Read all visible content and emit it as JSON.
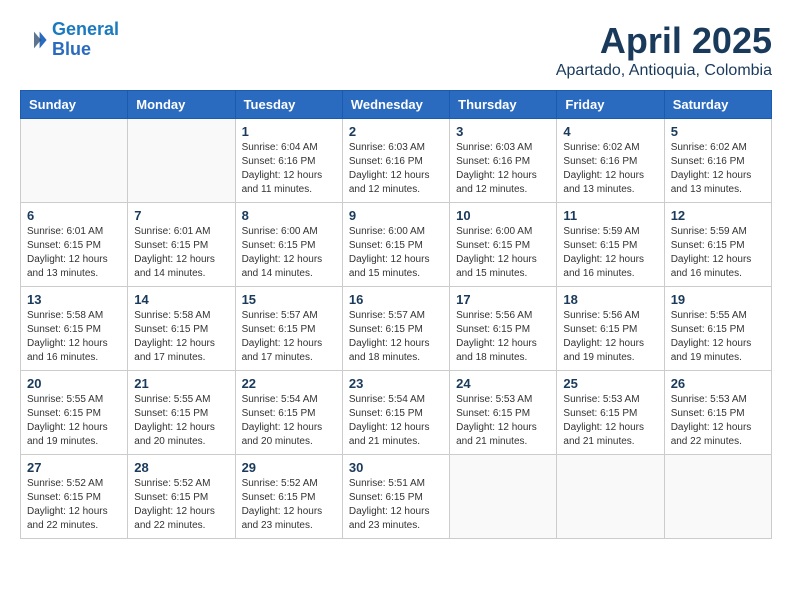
{
  "header": {
    "logo_line1": "General",
    "logo_line2": "Blue",
    "month_title": "April 2025",
    "subtitle": "Apartado, Antioquia, Colombia"
  },
  "days_of_week": [
    "Sunday",
    "Monday",
    "Tuesday",
    "Wednesday",
    "Thursday",
    "Friday",
    "Saturday"
  ],
  "weeks": [
    [
      {
        "day": "",
        "info": ""
      },
      {
        "day": "",
        "info": ""
      },
      {
        "day": "1",
        "info": "Sunrise: 6:04 AM\nSunset: 6:16 PM\nDaylight: 12 hours and 11 minutes."
      },
      {
        "day": "2",
        "info": "Sunrise: 6:03 AM\nSunset: 6:16 PM\nDaylight: 12 hours and 12 minutes."
      },
      {
        "day": "3",
        "info": "Sunrise: 6:03 AM\nSunset: 6:16 PM\nDaylight: 12 hours and 12 minutes."
      },
      {
        "day": "4",
        "info": "Sunrise: 6:02 AM\nSunset: 6:16 PM\nDaylight: 12 hours and 13 minutes."
      },
      {
        "day": "5",
        "info": "Sunrise: 6:02 AM\nSunset: 6:16 PM\nDaylight: 12 hours and 13 minutes."
      }
    ],
    [
      {
        "day": "6",
        "info": "Sunrise: 6:01 AM\nSunset: 6:15 PM\nDaylight: 12 hours and 13 minutes."
      },
      {
        "day": "7",
        "info": "Sunrise: 6:01 AM\nSunset: 6:15 PM\nDaylight: 12 hours and 14 minutes."
      },
      {
        "day": "8",
        "info": "Sunrise: 6:00 AM\nSunset: 6:15 PM\nDaylight: 12 hours and 14 minutes."
      },
      {
        "day": "9",
        "info": "Sunrise: 6:00 AM\nSunset: 6:15 PM\nDaylight: 12 hours and 15 minutes."
      },
      {
        "day": "10",
        "info": "Sunrise: 6:00 AM\nSunset: 6:15 PM\nDaylight: 12 hours and 15 minutes."
      },
      {
        "day": "11",
        "info": "Sunrise: 5:59 AM\nSunset: 6:15 PM\nDaylight: 12 hours and 16 minutes."
      },
      {
        "day": "12",
        "info": "Sunrise: 5:59 AM\nSunset: 6:15 PM\nDaylight: 12 hours and 16 minutes."
      }
    ],
    [
      {
        "day": "13",
        "info": "Sunrise: 5:58 AM\nSunset: 6:15 PM\nDaylight: 12 hours and 16 minutes."
      },
      {
        "day": "14",
        "info": "Sunrise: 5:58 AM\nSunset: 6:15 PM\nDaylight: 12 hours and 17 minutes."
      },
      {
        "day": "15",
        "info": "Sunrise: 5:57 AM\nSunset: 6:15 PM\nDaylight: 12 hours and 17 minutes."
      },
      {
        "day": "16",
        "info": "Sunrise: 5:57 AM\nSunset: 6:15 PM\nDaylight: 12 hours and 18 minutes."
      },
      {
        "day": "17",
        "info": "Sunrise: 5:56 AM\nSunset: 6:15 PM\nDaylight: 12 hours and 18 minutes."
      },
      {
        "day": "18",
        "info": "Sunrise: 5:56 AM\nSunset: 6:15 PM\nDaylight: 12 hours and 19 minutes."
      },
      {
        "day": "19",
        "info": "Sunrise: 5:55 AM\nSunset: 6:15 PM\nDaylight: 12 hours and 19 minutes."
      }
    ],
    [
      {
        "day": "20",
        "info": "Sunrise: 5:55 AM\nSunset: 6:15 PM\nDaylight: 12 hours and 19 minutes."
      },
      {
        "day": "21",
        "info": "Sunrise: 5:55 AM\nSunset: 6:15 PM\nDaylight: 12 hours and 20 minutes."
      },
      {
        "day": "22",
        "info": "Sunrise: 5:54 AM\nSunset: 6:15 PM\nDaylight: 12 hours and 20 minutes."
      },
      {
        "day": "23",
        "info": "Sunrise: 5:54 AM\nSunset: 6:15 PM\nDaylight: 12 hours and 21 minutes."
      },
      {
        "day": "24",
        "info": "Sunrise: 5:53 AM\nSunset: 6:15 PM\nDaylight: 12 hours and 21 minutes."
      },
      {
        "day": "25",
        "info": "Sunrise: 5:53 AM\nSunset: 6:15 PM\nDaylight: 12 hours and 21 minutes."
      },
      {
        "day": "26",
        "info": "Sunrise: 5:53 AM\nSunset: 6:15 PM\nDaylight: 12 hours and 22 minutes."
      }
    ],
    [
      {
        "day": "27",
        "info": "Sunrise: 5:52 AM\nSunset: 6:15 PM\nDaylight: 12 hours and 22 minutes."
      },
      {
        "day": "28",
        "info": "Sunrise: 5:52 AM\nSunset: 6:15 PM\nDaylight: 12 hours and 22 minutes."
      },
      {
        "day": "29",
        "info": "Sunrise: 5:52 AM\nSunset: 6:15 PM\nDaylight: 12 hours and 23 minutes."
      },
      {
        "day": "30",
        "info": "Sunrise: 5:51 AM\nSunset: 6:15 PM\nDaylight: 12 hours and 23 minutes."
      },
      {
        "day": "",
        "info": ""
      },
      {
        "day": "",
        "info": ""
      },
      {
        "day": "",
        "info": ""
      }
    ]
  ]
}
